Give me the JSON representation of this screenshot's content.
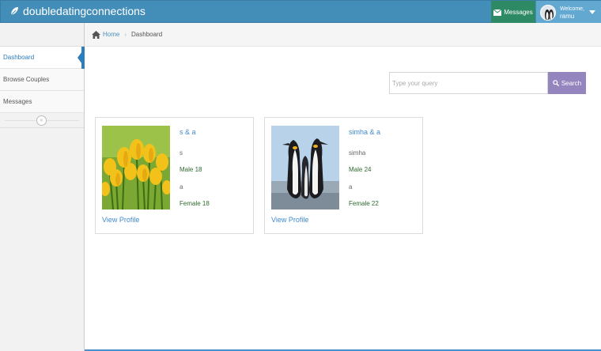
{
  "app": {
    "title": "doubledatingconnections"
  },
  "header": {
    "messages_label": "Messages",
    "welcome_label": "Welcome,",
    "user_name": "ramu"
  },
  "sidebar": {
    "items": [
      {
        "label": "Dashboard",
        "active": true
      },
      {
        "label": "Browse Couples",
        "active": false
      },
      {
        "label": "Messages",
        "active": false
      }
    ],
    "collapse_icon": "«"
  },
  "breadcrumb": {
    "home": "Home",
    "current": "Dashboard"
  },
  "search": {
    "placeholder": "Type your query",
    "button_label": "Search"
  },
  "profiles": [
    {
      "couple": "s & a",
      "person1_name": "s",
      "person1_info": "Male 18",
      "person2_name": "a",
      "person2_info": "Female 18",
      "link": "View Profile",
      "photo": "tulips"
    },
    {
      "couple": "simha & a",
      "person1_name": "simha",
      "person1_info": "Male 24",
      "person2_name": "a",
      "person2_info": "Female 22",
      "link": "View Profile",
      "photo": "penguins"
    }
  ],
  "colors": {
    "header": "#438eb9",
    "messages_button": "#2e8965",
    "user_button": "#62a8d1",
    "search_button": "#9585bf",
    "link": "#3f8ad0",
    "info_text": "#2e6b2e"
  }
}
